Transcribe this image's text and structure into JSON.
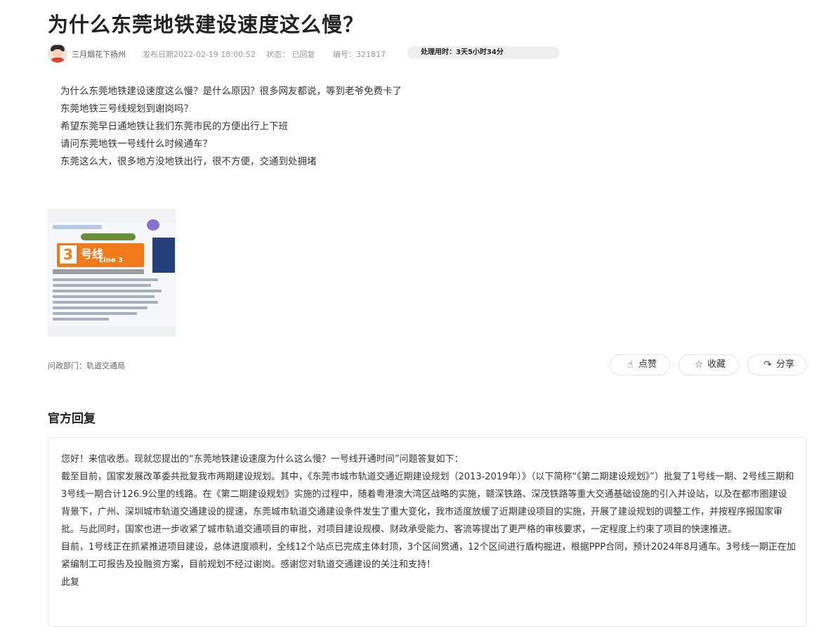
{
  "title": "为什么东莞地铁建设速度这么慢？",
  "meta": {
    "author": "三月烟花下扬州",
    "date": "发布日期2022-02-19 18:00:52",
    "status": "状态： 已回复",
    "number": "编号：321817",
    "duration": "处理用时：3天5小时34分"
  },
  "question": {
    "lines": [
      "为什么东莞地铁建设速度这么慢？是什么原因？很多网友都说，等到老爷免费卡了",
      "东莞地铁三号线规划到谢岗吗？",
      "希望东莞早日通地铁让我们东莞市民的方便出行上下班",
      "请问东莞地铁一号线什么时候通车？",
      "东莞这么大，很多地方没地铁出行，很不方便，交通到处拥堵"
    ]
  },
  "thumbnail": {
    "line_number": "3",
    "line_label_cn": "号线",
    "line_label_en": "Line 3"
  },
  "department": "问政部门：轨道交通局",
  "actions": {
    "like": "点赞",
    "favorite": "收藏",
    "share": "分享"
  },
  "reply": {
    "heading": "官方回复",
    "paragraphs": [
      "您好！来信收悉。现就您提出的“东莞地铁建设速度为什么这么慢？一号线开通时间”问题答复如下：",
      "截至目前，国家发展改革委共批复我市两期建设规划。其中，《东莞市城市轨道交通近期建设规划（2013-2019年）》（以下简称“《第二期建设规划》”）批复了1号线一期、2号线三期和3号线一期合计126.9公里的线路。在《第二期建设规划》实施的过程中，随着粤港澳大湾区战略的实施，赣深铁路、深茂铁路等重大交通基础设施的引入并设站，以及在都市圈建设背景下，广州、深圳城市轨道交通建设的提速，东莞城市轨道交通建设条件发生了重大变化，我市适度放缓了近期建设项目的实施，开展了建设规划的调整工作，并按程序报国家审批。与此同时，国家也进一步收紧了城市轨道交通项目的审批，对项目建设规模、财政承受能力、客流等提出了更严格的审核要求，一定程度上约束了项目的快速推进。",
      "目前，1号线正在抓紧推进项目建设，总体进度顺利，全线12个站点已完成主体封顶，3个区间贯通，12个区间进行盾构掘进，根据PPP合同，预计2024年8月通车。3号线一期正在加紧编制工可报告及投融资方案，目前规划不经过谢岗。感谢您对轨道交通建设的关注和支持！",
      "此复"
    ]
  }
}
